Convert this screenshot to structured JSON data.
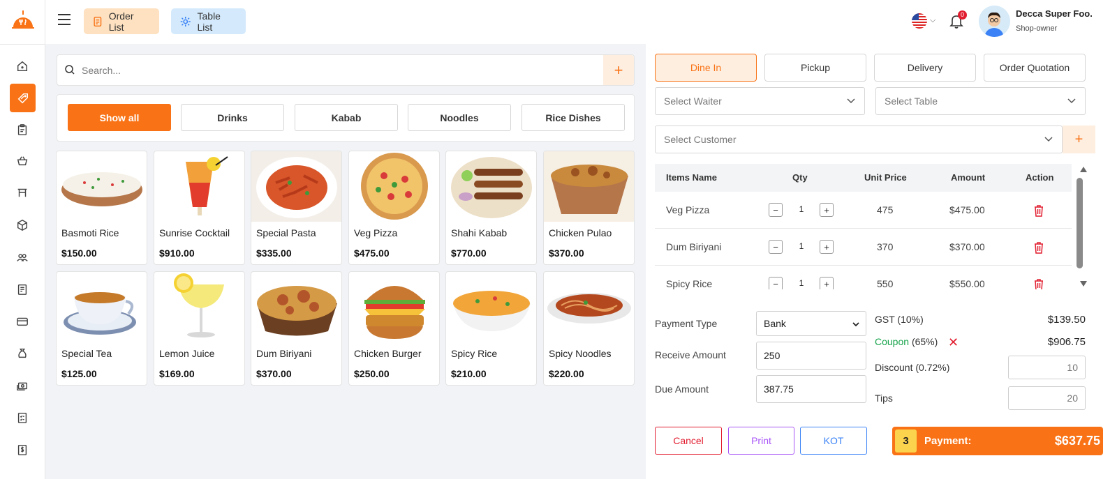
{
  "topbar": {
    "order_list_label": "Order List",
    "table_list_label": "Table List",
    "notification_count": "0",
    "user_name": "Decca Super Foo.",
    "user_role": "Shop-owner"
  },
  "search": {
    "placeholder": "Search...",
    "add_label": "+"
  },
  "categories": [
    "Show all",
    "Drinks",
    "Kabab",
    "Noodles",
    "Rice Dishes"
  ],
  "products": [
    {
      "name": "Basmoti Rice",
      "price": "$150.00"
    },
    {
      "name": "Sunrise Cocktail",
      "price": "$910.00"
    },
    {
      "name": "Special Pasta",
      "price": "$335.00"
    },
    {
      "name": "Veg Pizza",
      "price": "$475.00"
    },
    {
      "name": "Shahi Kabab",
      "price": "$770.00"
    },
    {
      "name": "Chicken Pulao",
      "price": "$370.00"
    },
    {
      "name": "Special Tea",
      "price": "$125.00"
    },
    {
      "name": "Lemon Juice",
      "price": "$169.00"
    },
    {
      "name": "Dum Biriyani",
      "price": "$370.00"
    },
    {
      "name": "Chicken Burger",
      "price": "$250.00"
    },
    {
      "name": "Spicy Rice",
      "price": "$210.00"
    },
    {
      "name": "Spicy Noodles",
      "price": "$220.00"
    }
  ],
  "order_tabs": [
    "Dine In",
    "Pickup",
    "Delivery",
    "Order Quotation"
  ],
  "selects": {
    "waiter": "Select Waiter",
    "table": "Select Table",
    "customer": "Select Customer",
    "customer_add": "+"
  },
  "cart": {
    "headers": [
      "Items Name",
      "Qty",
      "Unit Price",
      "Amount",
      "Action"
    ],
    "rows": [
      {
        "name": "Veg Pizza",
        "qty": "1",
        "unit_price": "475",
        "amount": "$475.00"
      },
      {
        "name": "Dum Biriyani",
        "qty": "1",
        "unit_price": "370",
        "amount": "$370.00"
      },
      {
        "name": "Spicy Rice",
        "qty": "1",
        "unit_price": "550",
        "amount": "$550.00"
      }
    ]
  },
  "payment": {
    "type_label": "Payment Type",
    "type_value": "Bank",
    "receive_label": "Receive Amount",
    "receive_value": "250",
    "due_label": "Due Amount",
    "due_value": "387.75"
  },
  "summary": {
    "gst_label": "GST (10%)",
    "gst_value": "$139.50",
    "coupon_label": "Coupon",
    "coupon_pct": "(65%)",
    "coupon_value": "$906.75",
    "discount_label": "Discount (0.72%)",
    "discount_value": "10",
    "tips_label": "Tips",
    "tips_value": "20"
  },
  "actions": {
    "cancel": "Cancel",
    "print": "Print",
    "kot": "KOT",
    "pay_count": "3",
    "pay_label": "Payment:",
    "pay_amount": "$637.75"
  },
  "colors": {
    "accent": "#f97316",
    "accent_light": "#fdeee0",
    "danger": "#e11d2f",
    "print": "#a855f7",
    "kot": "#3b82f6"
  }
}
